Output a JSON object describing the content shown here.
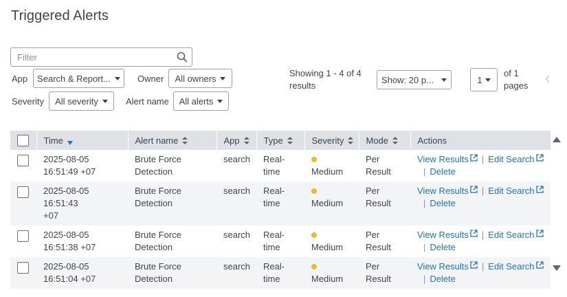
{
  "page": {
    "title": "Triggered Alerts"
  },
  "filter": {
    "placeholder": "Filter"
  },
  "controls": {
    "app_label": "App",
    "app_value": "Search & Report...",
    "owner_label": "Owner",
    "owner_value": "All owners",
    "severity_label": "Severity",
    "severity_value": "All severity",
    "alertname_label": "Alert name",
    "alertname_value": "All alerts"
  },
  "pagination": {
    "showing_line1": "Showing 1 - 4 of 4",
    "showing_line2": "results",
    "show_per_page": "Show: 20 p...",
    "current_page": "1",
    "of_line1": "of 1",
    "of_line2": "pages"
  },
  "table": {
    "headers": {
      "time": "Time",
      "alert_name": "Alert name",
      "app": "App",
      "type": "Type",
      "severity": "Severity",
      "mode": "Mode",
      "actions": "Actions"
    },
    "rows": [
      {
        "time_a": "2025-08-05",
        "time_b": "16:51:49 +07",
        "alert_a": "Brute Force",
        "alert_b": "Detection",
        "app": "search",
        "type_a": "Real-",
        "type_b": "time",
        "severity": "Medium",
        "mode_a": "Per",
        "mode_b": "Result",
        "view": "View Results",
        "edit": "Edit Search",
        "delete": "Delete"
      },
      {
        "time_a": "2025-08-05 16:51:43",
        "time_b": "+07",
        "alert_a": "Brute Force",
        "alert_b": "Detection",
        "app": "search",
        "type_a": "Real-",
        "type_b": "time",
        "severity": "Medium",
        "mode_a": "Per",
        "mode_b": "Result",
        "view": "View Results",
        "edit": "Edit Search",
        "delete": "Delete"
      },
      {
        "time_a": "2025-08-05",
        "time_b": "16:51:38 +07",
        "alert_a": "Brute Force",
        "alert_b": "Detection",
        "app": "search",
        "type_a": "Real-",
        "type_b": "time",
        "severity": "Medium",
        "mode_a": "Per",
        "mode_b": "Result",
        "view": "View Results",
        "edit": "Edit Search",
        "delete": "Delete"
      },
      {
        "time_a": "2025-08-05",
        "time_b": "16:51:04 +07",
        "alert_a": "Brute Force",
        "alert_b": "Detection",
        "app": "search",
        "type_a": "Real-",
        "type_b": "time",
        "severity": "Medium",
        "mode_a": "Per",
        "mode_b": "Result",
        "view": "View Results",
        "edit": "Edit Search",
        "delete": "Delete"
      }
    ]
  },
  "colors": {
    "link": "#1f72b8",
    "severity_medium": "#f1b72b",
    "header_bg": "#dee2e6",
    "alt_row_bg": "#f2f4f5"
  },
  "icons": [
    "search-icon",
    "chevron-down-icon",
    "chevron-left-icon",
    "sort-icon",
    "external-link-icon",
    "scroll-up-arrow",
    "scroll-down-arrow"
  ]
}
